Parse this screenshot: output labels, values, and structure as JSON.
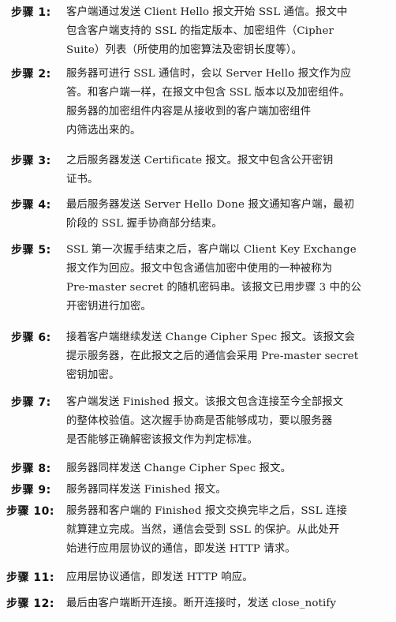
{
  "steps": [
    {
      "label": "步骤 1:",
      "lines": [
        "客户端通过发送 Client Hello 报文开始 SSL 通信。报文中",
        "包含客户端支持的 SSL 的指定版本、加密组件（Cipher",
        "Suite）列表（所使用的加密算法及密钥长度等）。"
      ]
    },
    {
      "label": "步骤 2:",
      "lines": [
        "服务器可进行 SSL 通信时，会以 Server Hello 报文作为应",
        "答。和客户端一样，在报文中包含 SSL 版本以及加密组件。",
        "服务器的加密组件内容是从接收到的客户端加密组件",
        "内筛选出来的。"
      ]
    },
    {
      "label": "步骤 3:",
      "lines": [
        "之后服务器发送 Certificate 报文。报文中包含公开密钥",
        "证书。"
      ]
    },
    {
      "label": "步骤 4:",
      "lines": [
        "最后服务器发送 Server Hello Done 报文通知客户端，最初",
        "阶段的 SSL 握手协商部分结束。"
      ]
    },
    {
      "label": "步骤 5:",
      "lines": [
        "SSL 第一次握手结束之后，客户端以 Client Key Exchange",
        "报文作为回应。报文中包含通信加密中使用的一种被称为",
        "Pre-master secret 的随机密码串。该报文已用步骤 3 中的公",
        "开密钥进行加密。"
      ]
    },
    {
      "label": "步骤 6:",
      "lines": [
        "接着客户端继续发送 Change Cipher Spec 报文。该报文会",
        "提示服务器，在此报文之后的通信会采用 Pre-master secret",
        "密钥加密。"
      ]
    },
    {
      "label": "步骤 7:",
      "lines": [
        "客户端发送 Finished 报文。该报文包含连接至今全部报文",
        "的整体校验值。这次握手协商是否能够成功，要以服务器",
        "是否能够正确解密该报文作为判定标准。"
      ]
    },
    {
      "label": "步骤 8:",
      "lines": [
        "服务器同样发送 Change Cipher Spec 报文。"
      ]
    },
    {
      "label": "步骤 9:",
      "lines": [
        "服务器同样发送 Finished 报文。"
      ]
    },
    {
      "label": "步骤 10:",
      "lines": [
        "服务器和客户端的 Finished 报文交换完毕之后，SSL 连接",
        "就算建立完成。当然，通信会受到 SSL 的保护。从此处开",
        "始进行应用层协议的通信，即发送 HTTP 请求。"
      ]
    },
    {
      "label": "步骤 11:",
      "lines": [
        "应用层协议通信，即发送 HTTP 响应。"
      ]
    },
    {
      "label": "步骤 12:",
      "lines": [
        "最后由客户端断开连接。断开连接时，发送 close_notify"
      ]
    }
  ]
}
